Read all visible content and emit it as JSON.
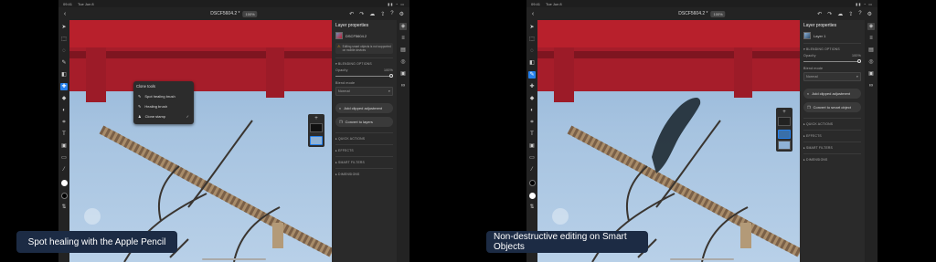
{
  "left": {
    "status_time": "09:41",
    "status_date": "Tue Jun 8",
    "doc_name": "DSCF5604.2 *",
    "zoom": "100%",
    "panel_title": "Layer properties",
    "layer_name": "DSCF5604.2",
    "warning": "Editing smart objects is not supported on mobile devices",
    "blending_section": "BLENDING OPTIONS",
    "opacity_label": "Opacity",
    "opacity_value": "100%",
    "blend_label": "Blend mode",
    "blend_value": "Normal",
    "btn1": "Add clipped adjustment",
    "btn2": "Convert to layers",
    "sections": [
      "QUICK ACTIONS",
      "EFFECTS",
      "SMART FILTERS",
      "DIMENSIONS"
    ],
    "popup_title": "Clone tools",
    "popup_items": [
      "Spot healing brush",
      "Healing brush",
      "Clone stamp"
    ],
    "popup_selected": 2,
    "caption": "Spot healing with the Apple Pencil"
  },
  "right": {
    "status_time": "09:41",
    "status_date": "Tue Jun 8",
    "doc_name": "DSCF5604.2 *",
    "zoom": "100%",
    "panel_title": "Layer properties",
    "layer_name": "Layer 1",
    "blending_section": "BLENDING OPTIONS",
    "opacity_label": "Opacity",
    "opacity_value": "100%",
    "blend_label": "Blend mode",
    "blend_value": "Normal",
    "btn1": "Add clipped adjustment",
    "btn2": "Convert to smart object",
    "sections": [
      "QUICK ACTIONS",
      "EFFECTS",
      "SMART FILTERS",
      "DIMENSIONS"
    ],
    "caption": "Non-destructive editing on Smart Objects"
  },
  "colors": {
    "accent": "#2680eb",
    "torii": "#b8202c",
    "caption_bg": "#1c2b44"
  },
  "icons": [
    "back-icon",
    "move-tool-icon",
    "brush-tool-icon",
    "clone-tool-icon",
    "eraser-icon",
    "crop-icon",
    "text-icon",
    "eyedropper-icon",
    "undo-icon",
    "redo-icon",
    "share-icon",
    "help-icon",
    "settings-icon",
    "layers-icon",
    "properties-icon",
    "warning-icon",
    "add-layer-icon",
    "chevron-down-icon",
    "check-icon"
  ]
}
